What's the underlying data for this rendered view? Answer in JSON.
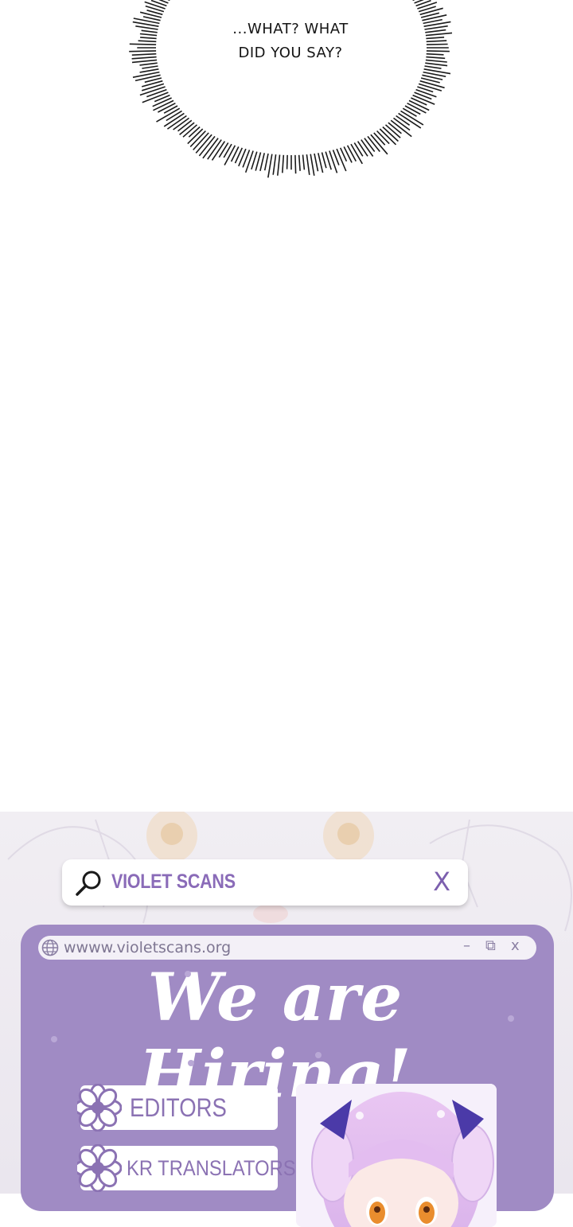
{
  "speech_bubble": {
    "line1": "...WHAT? WHAT",
    "line2": "DID YOU SAY?"
  },
  "search_bar": {
    "query": "VIOLET SCANS",
    "close_label": "X",
    "icon": "search-icon"
  },
  "browser_window": {
    "url": "wwww.violetscans.org",
    "minimize_label": "–",
    "restore_label": "⧉",
    "close_label": "x",
    "headline": "We are Hiring!"
  },
  "roles": [
    {
      "label": "EDITORS"
    },
    {
      "label": "KR TRANSLATORS"
    }
  ],
  "colors": {
    "window_bg": "#a08bc4",
    "accent_text": "#8b72b3",
    "speech_text": "#141414"
  }
}
